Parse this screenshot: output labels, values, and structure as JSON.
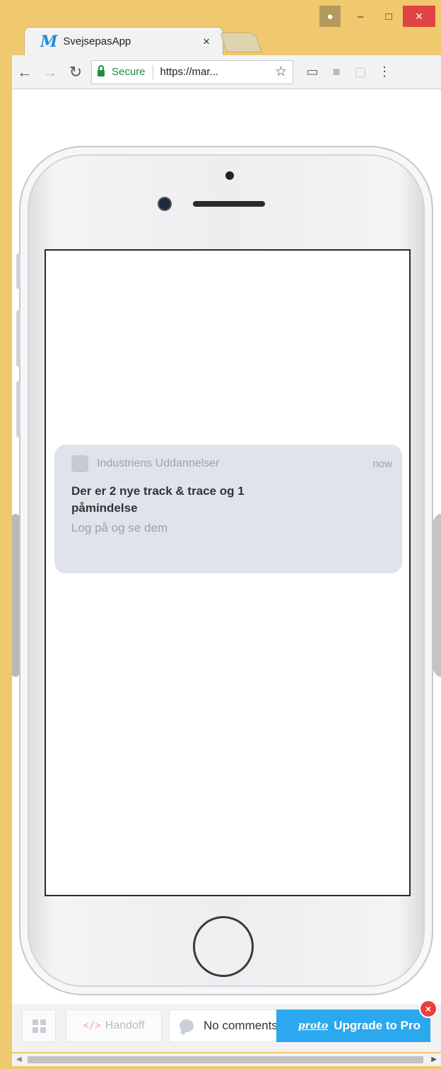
{
  "browser": {
    "tab_title": "SvejsepasApp",
    "tab_logo": "M",
    "tab_close": "×",
    "secure_label": "Secure",
    "url": "https://mar...",
    "window_controls": {
      "minimize": "–",
      "maximize": "□",
      "close": "×"
    }
  },
  "notification": {
    "app_name": "Industriens Uddannelser",
    "time": "now",
    "title": "Der er 2 nye track & trace og 1 påmindelse",
    "body": "Log på og se dem"
  },
  "bottombar": {
    "handoff_label": "Handoff",
    "handoff_icon_glyph": "</>",
    "comments_label": "No comments",
    "upgrade_label": "Upgrade to Pro",
    "upgrade_brand": "proto",
    "close_glyph": "×"
  },
  "icons": {
    "back": "arrow-left-icon",
    "forward": "arrow-right-icon",
    "reload": "reload-icon",
    "star": "star-icon",
    "cast": "cast-icon",
    "pdf": "pdf-icon",
    "extension": "extension-icon",
    "menu": "more-vertical-icon"
  }
}
